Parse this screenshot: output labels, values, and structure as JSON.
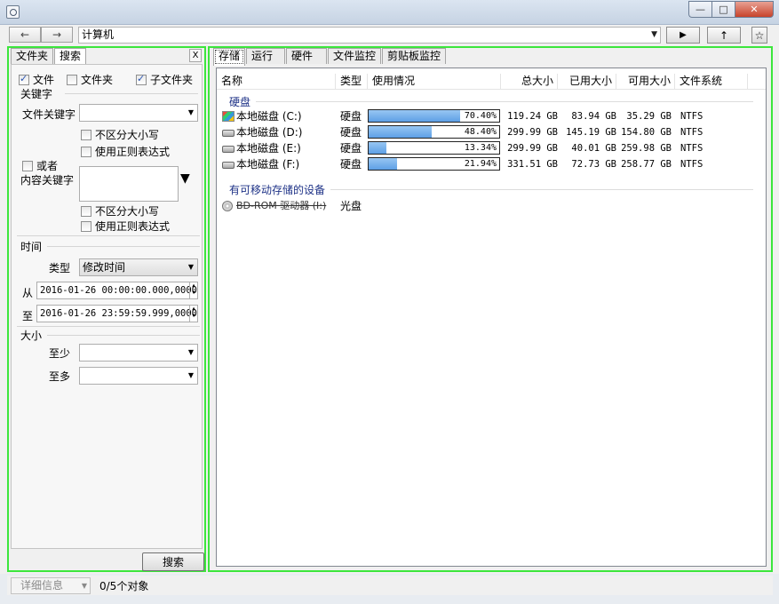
{
  "address": {
    "back": "←",
    "forward": "→",
    "path": "计算机",
    "go": "▶",
    "up": "↑",
    "star": "☆"
  },
  "left": {
    "tabs": [
      "文件夹",
      "搜索"
    ],
    "close": "X",
    "chk_file": "文件",
    "chk_folder": "文件夹",
    "chk_subfolder": "子文件夹",
    "keyword_heading": "关键字",
    "file_keyword_label": "文件关键字",
    "case_insensitive": "不区分大小写",
    "use_regex": "使用正则表达式",
    "or_label": "或者",
    "content_keyword_label": "内容关键字",
    "time_heading": "时间",
    "type_label": "类型",
    "type_value": "修改时间",
    "from_label": "从",
    "from_value": "2016-01-26 00:00:00.000,0000",
    "to_label": "至",
    "to_value": "2016-01-26 23:59:59.999,0000",
    "size_heading": "大小",
    "min_label": "至少",
    "max_label": "至多",
    "search_button": "搜索"
  },
  "right": {
    "tabs": [
      "存储",
      "运行",
      "硬件",
      "文件监控",
      "剪贴板监控"
    ],
    "columns": [
      "名称",
      "类型",
      "使用情况",
      "总大小",
      "已用大小",
      "可用大小",
      "文件系统"
    ],
    "group_disks": "硬盘",
    "disks": [
      {
        "name": "本地磁盘 (C:)",
        "type": "硬盘",
        "pct": "70.40%",
        "fill": 0.704,
        "total": "119.24 GB",
        "used": "83.94 GB",
        "free": "35.29 GB",
        "fs": "NTFS",
        "icon": "windows-drive-icon"
      },
      {
        "name": "本地磁盘 (D:)",
        "type": "硬盘",
        "pct": "48.40%",
        "fill": 0.484,
        "total": "299.99 GB",
        "used": "145.19 GB",
        "free": "154.80 GB",
        "fs": "NTFS",
        "icon": "drive-icon"
      },
      {
        "name": "本地磁盘 (E:)",
        "type": "硬盘",
        "pct": "13.34%",
        "fill": 0.1334,
        "total": "299.99 GB",
        "used": "40.01 GB",
        "free": "259.98 GB",
        "fs": "NTFS",
        "icon": "drive-icon"
      },
      {
        "name": "本地磁盘 (F:)",
        "type": "硬盘",
        "pct": "21.94%",
        "fill": 0.2194,
        "total": "331.51 GB",
        "used": "72.73 GB",
        "free": "258.77 GB",
        "fs": "NTFS",
        "icon": "drive-icon"
      }
    ],
    "group_removable": "有可移动存储的设备",
    "removable": [
      {
        "name": "BD-ROM 驱动器 (I:)",
        "type": "光盘"
      }
    ]
  },
  "status": {
    "detail": "详细信息",
    "objects": "0/5个对象"
  }
}
